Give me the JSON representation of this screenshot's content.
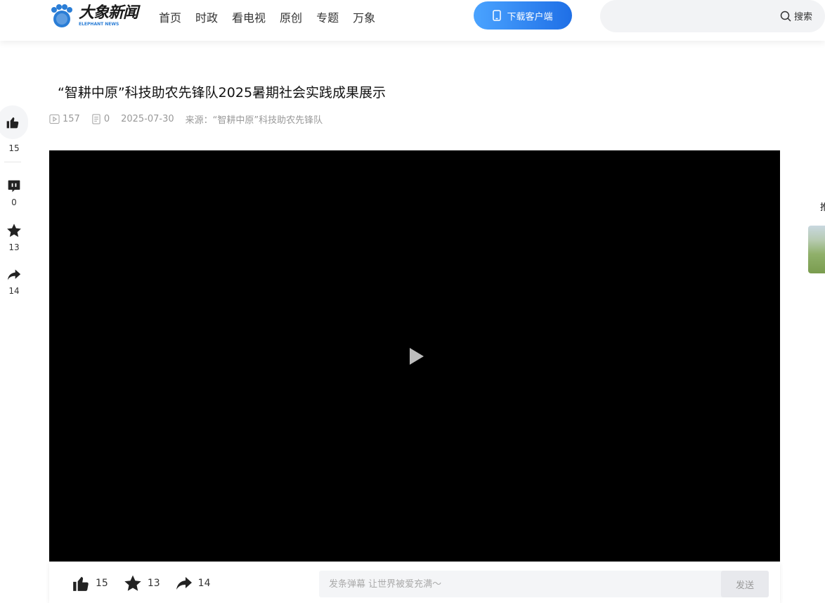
{
  "header": {
    "logo_cn": "大象新闻",
    "logo_en": "ELEPHANT NEWS",
    "nav": [
      "首页",
      "时政",
      "看电视",
      "原创",
      "专题",
      "万象"
    ],
    "download_label": "下载客户端",
    "search_label": "搜索",
    "search_placeholder": ""
  },
  "article": {
    "title": "“智耕中原”科技助农先锋队2025暑期社会实践成果展示",
    "views": "157",
    "comments": "0",
    "date": "2025-07-30",
    "source": "来源：“智耕中原”科技助农先锋队"
  },
  "rail": {
    "likes": "15",
    "comments": "0",
    "favorites": "13",
    "shares": "14"
  },
  "video_bar": {
    "likes": "15",
    "favorites": "13",
    "shares": "14",
    "danmaku_placeholder": "发条弹幕 让世界被爱充满～",
    "send_label": "发送"
  },
  "sidebar": {
    "label_fragment": "推"
  },
  "colors": {
    "accent": "#1f6fe6",
    "video_bg": "#000000"
  }
}
